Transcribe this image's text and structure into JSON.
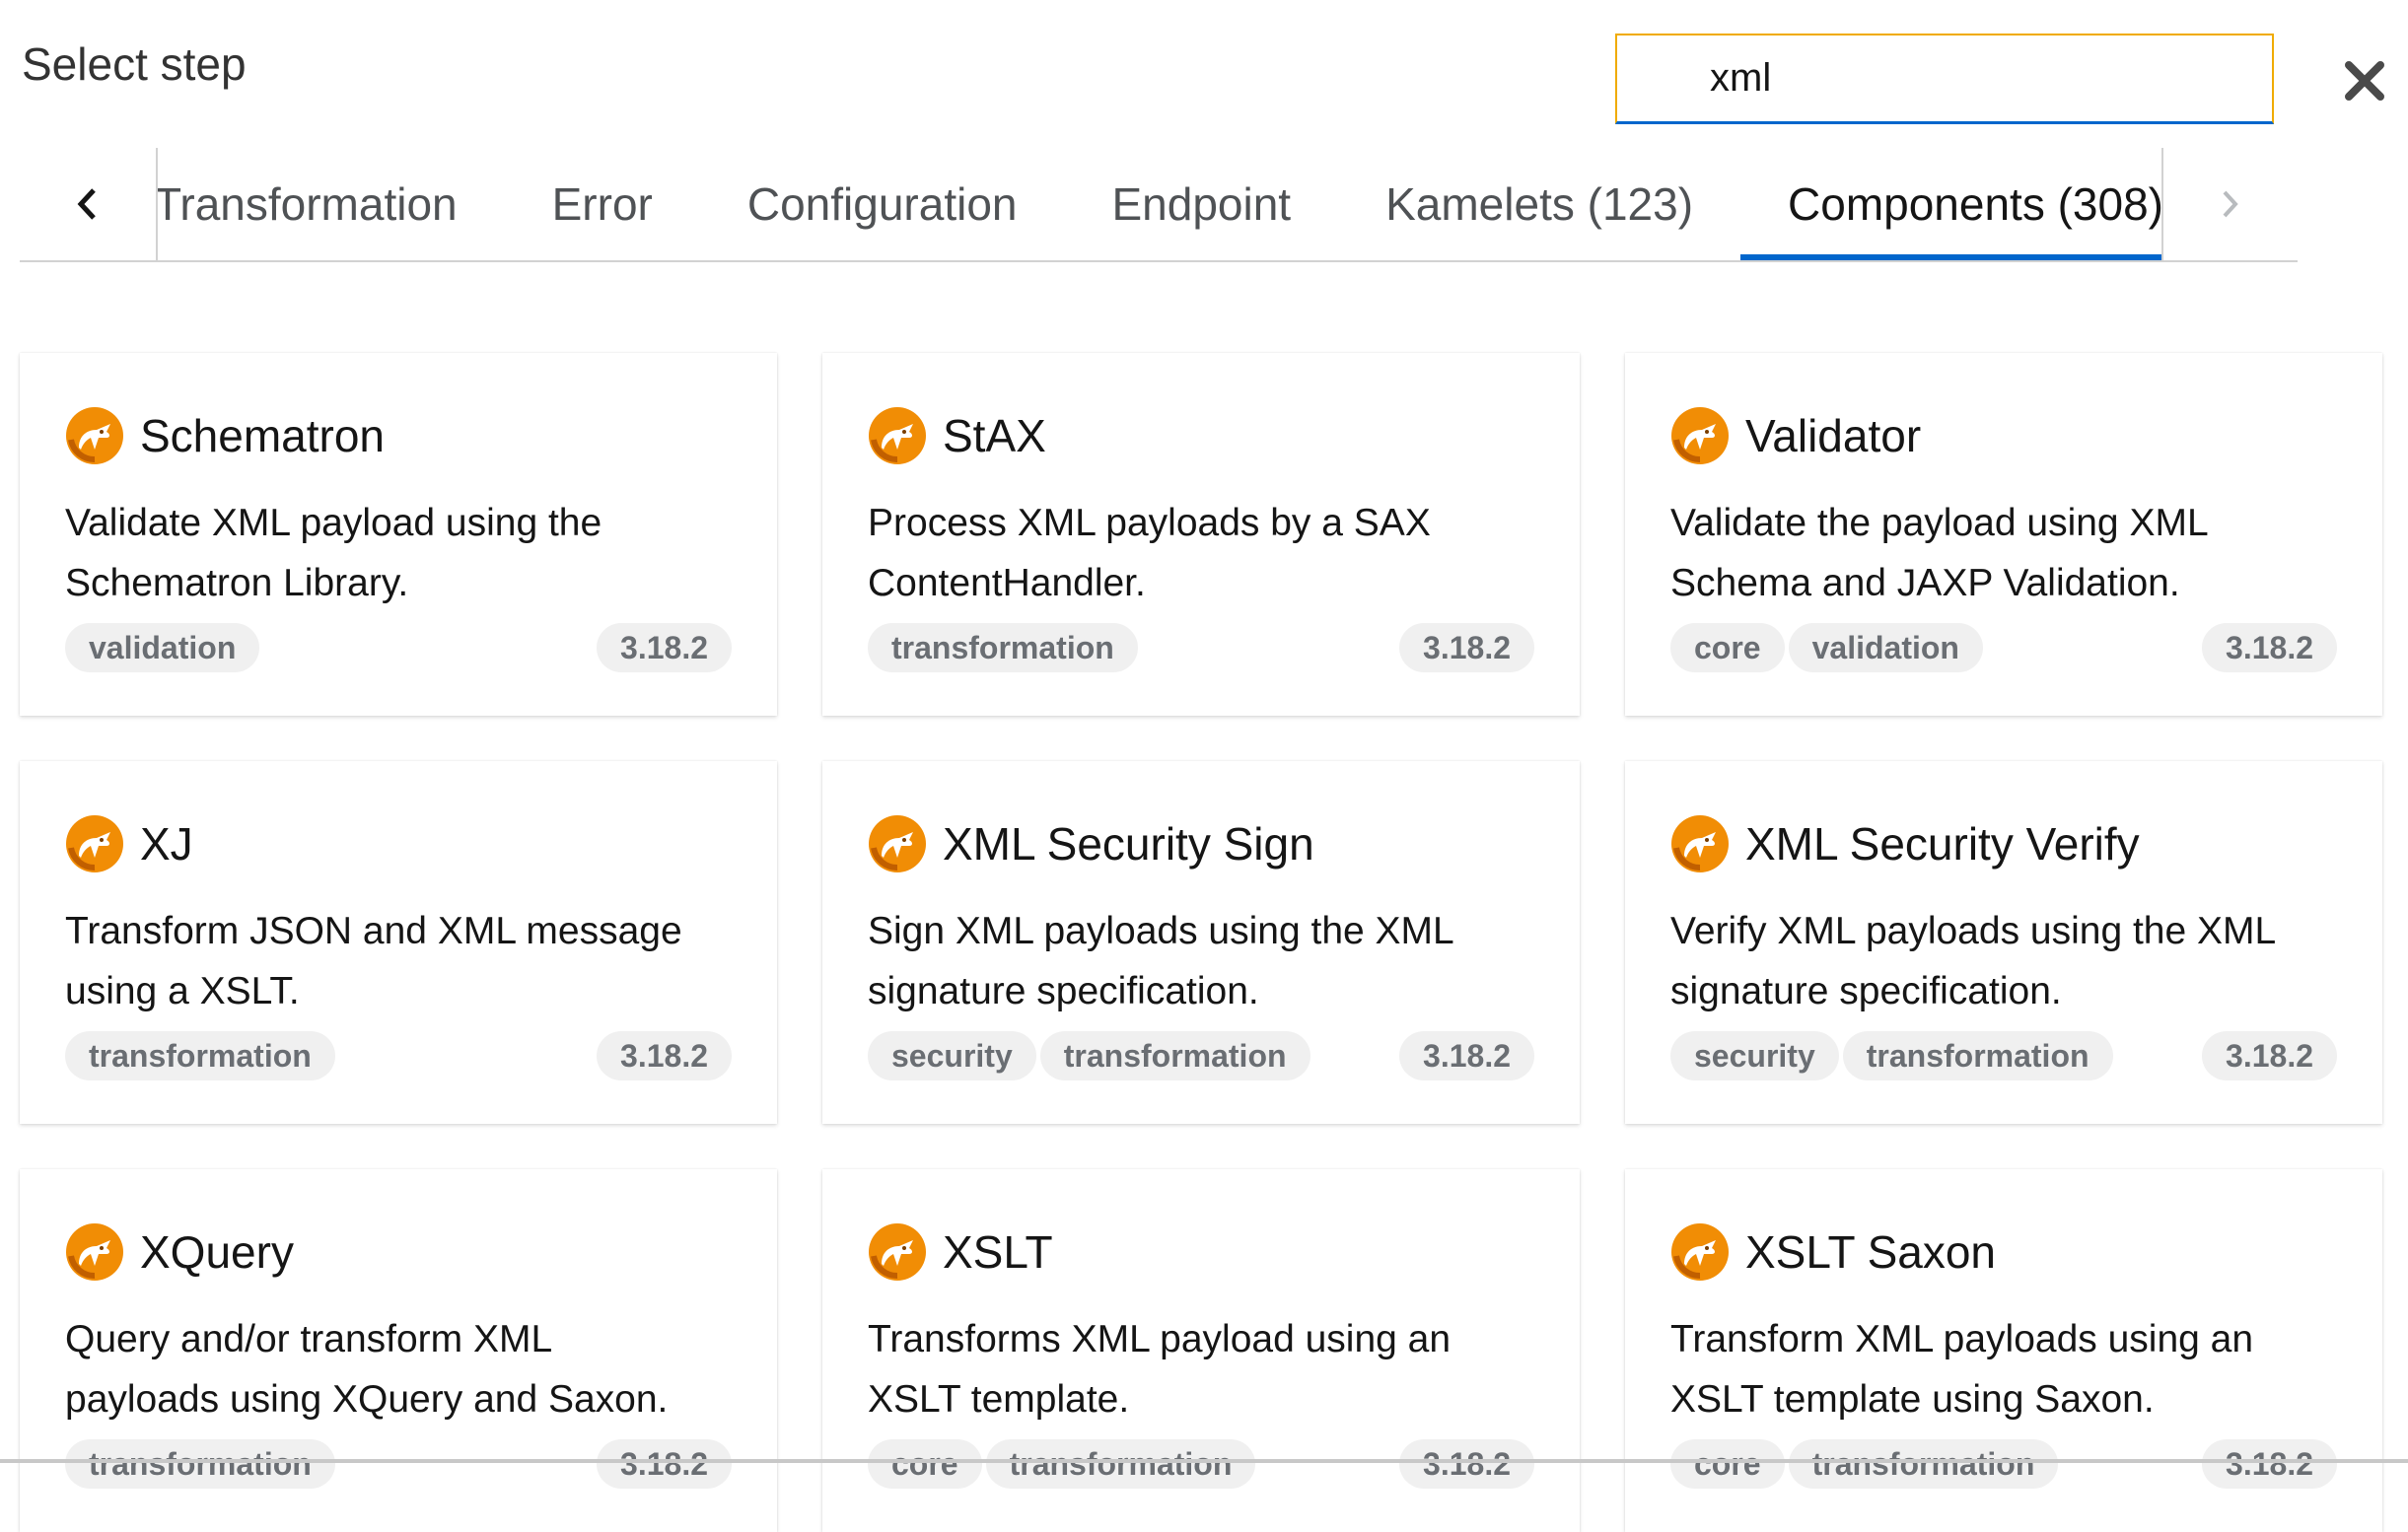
{
  "header": {
    "title": "Select step"
  },
  "search": {
    "value": "xml",
    "placeholder": ""
  },
  "tabs": {
    "items": [
      {
        "label": "Transformation",
        "active": false
      },
      {
        "label": "Error",
        "active": false
      },
      {
        "label": "Configuration",
        "active": false
      },
      {
        "label": "Endpoint",
        "active": false
      },
      {
        "label": "Kamelets (123)",
        "active": false
      },
      {
        "label": "Components (308)",
        "active": true
      }
    ]
  },
  "icons": {
    "close": "close-icon",
    "prev": "chevron-left-icon",
    "next": "chevron-right-icon",
    "card_logo": "camel-logo-icon"
  },
  "colors": {
    "accent": "#0066cc",
    "search_border": "#f0ab00",
    "logo_orange": "#f18d05",
    "badge_bg": "#f0f0f0",
    "badge_text": "#6a6e73"
  },
  "cards": [
    {
      "title": "Schematron",
      "desc1": "Validate XML payload using the",
      "desc2": "Schematron Library.",
      "badges": [
        "validation"
      ],
      "version": "3.18.2"
    },
    {
      "title": "StAX",
      "desc1": "Process XML payloads by a SAX",
      "desc2": "ContentHandler.",
      "badges": [
        "transformation"
      ],
      "version": "3.18.2"
    },
    {
      "title": "Validator",
      "desc1": "Validate the payload using XML",
      "desc2": "Schema and JAXP Validation.",
      "badges": [
        "core",
        "validation"
      ],
      "version": "3.18.2"
    },
    {
      "title": "XJ",
      "desc1": "Transform JSON and XML message",
      "desc2": "using a XSLT.",
      "badges": [
        "transformation"
      ],
      "version": "3.18.2"
    },
    {
      "title": "XML Security Sign",
      "desc1": "Sign XML payloads using the XML",
      "desc2": "signature specification.",
      "badges": [
        "security",
        "transformation"
      ],
      "version": "3.18.2"
    },
    {
      "title": "XML Security Verify",
      "desc1": "Verify XML payloads using the XML",
      "desc2": "signature specification.",
      "badges": [
        "security",
        "transformation"
      ],
      "version": "3.18.2"
    },
    {
      "title": "XQuery",
      "desc1": "Query and/or transform XML",
      "desc2": "payloads using XQuery and Saxon.",
      "badges": [
        "transformation"
      ],
      "version": "3.18.2"
    },
    {
      "title": "XSLT",
      "desc1": "Transforms XML payload using an",
      "desc2": "XSLT template.",
      "badges": [
        "core",
        "transformation"
      ],
      "version": "3.18.2"
    },
    {
      "title": "XSLT Saxon",
      "desc1": "Transform XML payloads using an",
      "desc2": "XSLT template using Saxon.",
      "badges": [
        "core",
        "transformation"
      ],
      "version": "3.18.2"
    }
  ]
}
